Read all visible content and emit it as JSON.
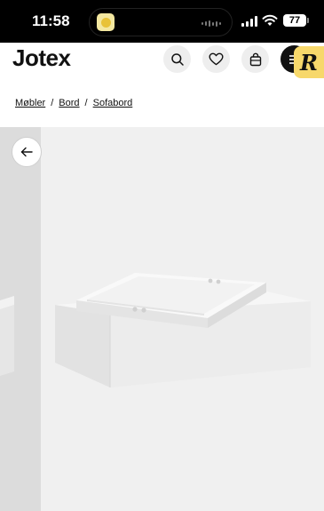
{
  "status_bar": {
    "time": "11:58",
    "battery": "77",
    "icons": [
      "app-activity-icon",
      "audio-wave-icon",
      "signal-icon",
      "wifi-icon",
      "battery-icon"
    ]
  },
  "header": {
    "logo": "Jotex",
    "actions": [
      "search-icon",
      "heart-icon",
      "bag-icon",
      "menu-icon"
    ]
  },
  "overlay_badge": {
    "letter": "R"
  },
  "breadcrumb": {
    "items": [
      "Møbler",
      "Bord",
      "Sofabord"
    ],
    "separator": "/"
  },
  "gallery": {
    "back_icon": "arrow-left-icon",
    "image_subject": "white storage box coffee table with lid tray"
  },
  "colors": {
    "background": "#ffffff",
    "gallery_bg": "#f0f0f0",
    "badge_yellow": "#f7d86b",
    "text": "#111111"
  }
}
